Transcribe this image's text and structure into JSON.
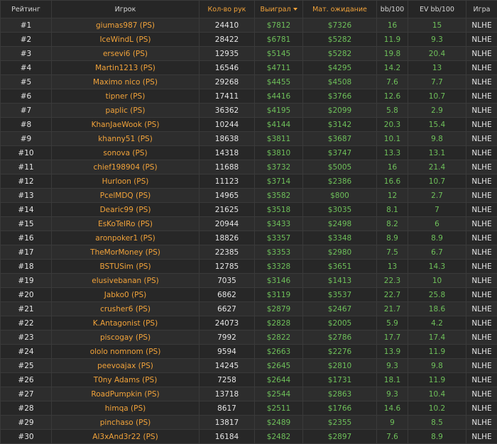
{
  "headers": {
    "rank": "Рейтинг",
    "player": "Игрок",
    "hands": "Кол-во рук",
    "won": "Выиграл",
    "expected": "Мат. ожидание",
    "bb100": "bb/100",
    "ev_bb100": "EV bb/100",
    "game": "Игра"
  },
  "sort_icon": "sort-descending-icon",
  "colors": {
    "accent": "#f2a33a",
    "positive": "#6ec05a",
    "background": "#2a2a2a"
  },
  "rows": [
    {
      "rank": "#1",
      "player": "giumas987 (PS)",
      "hands": "24410",
      "won": "$7812",
      "expected": "$7326",
      "bb100": "16",
      "ev_bb100": "15",
      "game": "NLHE"
    },
    {
      "rank": "#2",
      "player": "IceWindL (PS)",
      "hands": "28422",
      "won": "$6781",
      "expected": "$5282",
      "bb100": "11.9",
      "ev_bb100": "9.3",
      "game": "NLHE"
    },
    {
      "rank": "#3",
      "player": "ersevi6 (PS)",
      "hands": "12935",
      "won": "$5145",
      "expected": "$5282",
      "bb100": "19.8",
      "ev_bb100": "20.4",
      "game": "NLHE"
    },
    {
      "rank": "#4",
      "player": "Martin1213 (PS)",
      "hands": "16546",
      "won": "$4711",
      "expected": "$4295",
      "bb100": "14.2",
      "ev_bb100": "13",
      "game": "NLHE"
    },
    {
      "rank": "#5",
      "player": "Maximo nico (PS)",
      "hands": "29268",
      "won": "$4455",
      "expected": "$4508",
      "bb100": "7.6",
      "ev_bb100": "7.7",
      "game": "NLHE"
    },
    {
      "rank": "#6",
      "player": "tipner (PS)",
      "hands": "17411",
      "won": "$4416",
      "expected": "$3766",
      "bb100": "12.6",
      "ev_bb100": "10.7",
      "game": "NLHE"
    },
    {
      "rank": "#7",
      "player": "paplic (PS)",
      "hands": "36362",
      "won": "$4195",
      "expected": "$2099",
      "bb100": "5.8",
      "ev_bb100": "2.9",
      "game": "NLHE"
    },
    {
      "rank": "#8",
      "player": "KhanJaeWook (PS)",
      "hands": "10244",
      "won": "$4144",
      "expected": "$3142",
      "bb100": "20.3",
      "ev_bb100": "15.4",
      "game": "NLHE"
    },
    {
      "rank": "#9",
      "player": "khanny51 (PS)",
      "hands": "18638",
      "won": "$3811",
      "expected": "$3687",
      "bb100": "10.1",
      "ev_bb100": "9.8",
      "game": "NLHE"
    },
    {
      "rank": "#10",
      "player": "sonova (PS)",
      "hands": "14318",
      "won": "$3810",
      "expected": "$3747",
      "bb100": "13.3",
      "ev_bb100": "13.1",
      "game": "NLHE"
    },
    {
      "rank": "#11",
      "player": "chief198904 (PS)",
      "hands": "11688",
      "won": "$3732",
      "expected": "$5005",
      "bb100": "16",
      "ev_bb100": "21.4",
      "game": "NLHE"
    },
    {
      "rank": "#12",
      "player": "Hurloon (PS)",
      "hands": "11123",
      "won": "$3714",
      "expected": "$2386",
      "bb100": "16.6",
      "ev_bb100": "10.7",
      "game": "NLHE"
    },
    {
      "rank": "#13",
      "player": "PcelMDQ (PS)",
      "hands": "14965",
      "won": "$3582",
      "expected": "$800",
      "bb100": "12",
      "ev_bb100": "2.7",
      "game": "NLHE"
    },
    {
      "rank": "#14",
      "player": "Dearic99 (PS)",
      "hands": "21625",
      "won": "$3518",
      "expected": "$3035",
      "bb100": "8.1",
      "ev_bb100": "7",
      "game": "NLHE"
    },
    {
      "rank": "#15",
      "player": "EsKoTeIRo (PS)",
      "hands": "20944",
      "won": "$3433",
      "expected": "$2498",
      "bb100": "8.2",
      "ev_bb100": "6",
      "game": "NLHE"
    },
    {
      "rank": "#16",
      "player": "aronpoker1 (PS)",
      "hands": "18826",
      "won": "$3357",
      "expected": "$3348",
      "bb100": "8.9",
      "ev_bb100": "8.9",
      "game": "NLHE"
    },
    {
      "rank": "#17",
      "player": "TheMorMoney (PS)",
      "hands": "22385",
      "won": "$3353",
      "expected": "$2980",
      "bb100": "7.5",
      "ev_bb100": "6.7",
      "game": "NLHE"
    },
    {
      "rank": "#18",
      "player": "BSTUSim (PS)",
      "hands": "12785",
      "won": "$3328",
      "expected": "$3651",
      "bb100": "13",
      "ev_bb100": "14.3",
      "game": "NLHE"
    },
    {
      "rank": "#19",
      "player": "elusivebanan (PS)",
      "hands": "7035",
      "won": "$3146",
      "expected": "$1413",
      "bb100": "22.3",
      "ev_bb100": "10",
      "game": "NLHE"
    },
    {
      "rank": "#20",
      "player": "Jabko0 (PS)",
      "hands": "6862",
      "won": "$3119",
      "expected": "$3537",
      "bb100": "22.7",
      "ev_bb100": "25.8",
      "game": "NLHE"
    },
    {
      "rank": "#21",
      "player": "crusher6 (PS)",
      "hands": "6627",
      "won": "$2879",
      "expected": "$2467",
      "bb100": "21.7",
      "ev_bb100": "18.6",
      "game": "NLHE"
    },
    {
      "rank": "#22",
      "player": "K.Antagonist (PS)",
      "hands": "24073",
      "won": "$2828",
      "expected": "$2005",
      "bb100": "5.9",
      "ev_bb100": "4.2",
      "game": "NLHE"
    },
    {
      "rank": "#23",
      "player": "piscogay (PS)",
      "hands": "7992",
      "won": "$2822",
      "expected": "$2786",
      "bb100": "17.7",
      "ev_bb100": "17.4",
      "game": "NLHE"
    },
    {
      "rank": "#24",
      "player": "ololo nomnom (PS)",
      "hands": "9594",
      "won": "$2663",
      "expected": "$2276",
      "bb100": "13.9",
      "ev_bb100": "11.9",
      "game": "NLHE"
    },
    {
      "rank": "#25",
      "player": "peevoajax (PS)",
      "hands": "14245",
      "won": "$2645",
      "expected": "$2810",
      "bb100": "9.3",
      "ev_bb100": "9.8",
      "game": "NLHE"
    },
    {
      "rank": "#26",
      "player": "T0ny Adams (PS)",
      "hands": "7258",
      "won": "$2644",
      "expected": "$1731",
      "bb100": "18.1",
      "ev_bb100": "11.9",
      "game": "NLHE"
    },
    {
      "rank": "#27",
      "player": "RoadPumpkin (PS)",
      "hands": "13718",
      "won": "$2544",
      "expected": "$2863",
      "bb100": "9.3",
      "ev_bb100": "10.4",
      "game": "NLHE"
    },
    {
      "rank": "#28",
      "player": "himqa (PS)",
      "hands": "8617",
      "won": "$2511",
      "expected": "$1766",
      "bb100": "14.6",
      "ev_bb100": "10.2",
      "game": "NLHE"
    },
    {
      "rank": "#29",
      "player": "pinchaso (PS)",
      "hands": "13817",
      "won": "$2489",
      "expected": "$2355",
      "bb100": "9",
      "ev_bb100": "8.5",
      "game": "NLHE"
    },
    {
      "rank": "#30",
      "player": "Al3xAnd3r22 (PS)",
      "hands": "16184",
      "won": "$2482",
      "expected": "$2897",
      "bb100": "7.6",
      "ev_bb100": "8.9",
      "game": "NLHE"
    }
  ]
}
